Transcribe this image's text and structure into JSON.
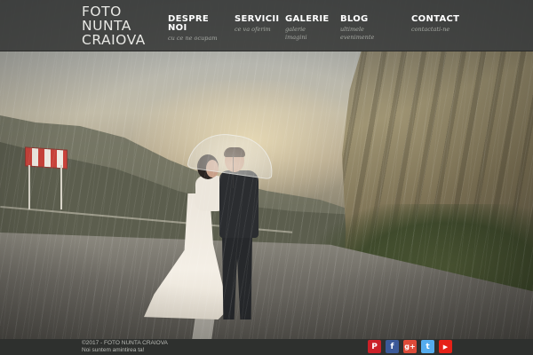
{
  "logo": {
    "line1": "FOTO",
    "line2": "NUNTA",
    "line3": "CRAIOVA"
  },
  "nav": [
    {
      "title": "DESPRE NOI",
      "subtitle": "cu ce ne ocupam"
    },
    {
      "title": "SERVICII",
      "subtitle": "ce va oferim"
    },
    {
      "title": "GALERIE",
      "subtitle": "galerie imagini"
    },
    {
      "title": "BLOG",
      "subtitle": "ultimele evenimente"
    },
    {
      "title": "CONTACT",
      "subtitle": "contactati-ne"
    }
  ],
  "footer": {
    "copyright": "©2017 - FOTO NUNTA CRAIOVA",
    "tagline": "Noi suntem amintirea ta!"
  },
  "social": [
    {
      "icon": "pinterest-icon",
      "glyph": "P",
      "color": "#cb2027"
    },
    {
      "icon": "facebook-icon",
      "glyph": "f",
      "color": "#3b5998"
    },
    {
      "icon": "google-plus-icon",
      "glyph": "g+",
      "color": "#dd4b39"
    },
    {
      "icon": "twitter-icon",
      "glyph": "t",
      "color": "#55acee"
    },
    {
      "icon": "youtube-icon",
      "glyph": "▶",
      "color": "#e62117"
    }
  ]
}
